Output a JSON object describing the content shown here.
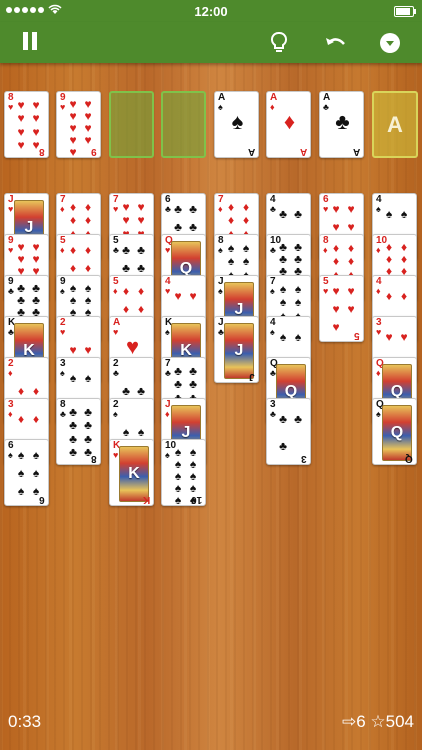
{
  "status": {
    "time": "12:00"
  },
  "toolbar": {
    "pause": "pause-icon",
    "hint": "lightbulb-icon",
    "undo": "undo-icon",
    "menu": "menu-dropdown-icon"
  },
  "freecells": [
    {
      "rank": "8",
      "suit": "♥",
      "color": "red"
    },
    {
      "rank": "9",
      "suit": "♥",
      "color": "red"
    },
    null,
    null
  ],
  "foundations": [
    {
      "rank": "A",
      "suit": "♠",
      "color": "black"
    },
    {
      "rank": "A",
      "suit": "♦",
      "color": "red"
    },
    {
      "rank": "A",
      "suit": "♣",
      "color": "black"
    },
    {
      "placeholder": "A"
    }
  ],
  "tableau": [
    [
      {
        "rank": "J",
        "suit": "♥",
        "color": "red"
      },
      {
        "rank": "9",
        "suit": "♥",
        "color": "red"
      },
      {
        "rank": "9",
        "suit": "♣",
        "color": "black"
      },
      {
        "rank": "K",
        "suit": "♣",
        "color": "black"
      },
      {
        "rank": "2",
        "suit": "♦",
        "color": "red"
      },
      {
        "rank": "3",
        "suit": "♦",
        "color": "red"
      },
      {
        "rank": "6",
        "suit": "♠",
        "color": "black"
      }
    ],
    [
      {
        "rank": "7",
        "suit": "♦",
        "color": "red"
      },
      {
        "rank": "5",
        "suit": "♦",
        "color": "red"
      },
      {
        "rank": "9",
        "suit": "♠",
        "color": "black"
      },
      {
        "rank": "2",
        "suit": "♥",
        "color": "red"
      },
      {
        "rank": "3",
        "suit": "♠",
        "color": "black"
      },
      {
        "rank": "8",
        "suit": "♣",
        "color": "black"
      }
    ],
    [
      {
        "rank": "7",
        "suit": "♥",
        "color": "red"
      },
      {
        "rank": "5",
        "suit": "♣",
        "color": "black"
      },
      {
        "rank": "5",
        "suit": "♦",
        "color": "red"
      },
      {
        "rank": "A",
        "suit": "♥",
        "color": "red"
      },
      {
        "rank": "2",
        "suit": "♣",
        "color": "black"
      },
      {
        "rank": "2",
        "suit": "♠",
        "color": "black"
      },
      {
        "rank": "K",
        "suit": "♥",
        "color": "red"
      }
    ],
    [
      {
        "rank": "6",
        "suit": "♣",
        "color": "black"
      },
      {
        "rank": "Q",
        "suit": "♥",
        "color": "red"
      },
      {
        "rank": "4",
        "suit": "♥",
        "color": "red"
      },
      {
        "rank": "K",
        "suit": "♠",
        "color": "black"
      },
      {
        "rank": "7",
        "suit": "♣",
        "color": "black"
      },
      {
        "rank": "J",
        "suit": "♦",
        "color": "red"
      },
      {
        "rank": "10",
        "suit": "♠",
        "color": "black"
      }
    ],
    [
      {
        "rank": "7",
        "suit": "♦",
        "color": "red"
      },
      {
        "rank": "8",
        "suit": "♠",
        "color": "black"
      },
      {
        "rank": "J",
        "suit": "♠",
        "color": "black"
      },
      {
        "rank": "J",
        "suit": "♣",
        "color": "black"
      }
    ],
    [
      {
        "rank": "4",
        "suit": "♣",
        "color": "black"
      },
      {
        "rank": "10",
        "suit": "♣",
        "color": "black"
      },
      {
        "rank": "7",
        "suit": "♠",
        "color": "black"
      },
      {
        "rank": "4",
        "suit": "♠",
        "color": "black"
      },
      {
        "rank": "Q",
        "suit": "♣",
        "color": "black"
      },
      {
        "rank": "3",
        "suit": "♣",
        "color": "black"
      }
    ],
    [
      {
        "rank": "6",
        "suit": "♥",
        "color": "red"
      },
      {
        "rank": "8",
        "suit": "♦",
        "color": "red"
      },
      {
        "rank": "5",
        "suit": "♥",
        "color": "red"
      }
    ],
    [
      {
        "rank": "4",
        "suit": "♠",
        "color": "black"
      },
      {
        "rank": "10",
        "suit": "♦",
        "color": "red"
      },
      {
        "rank": "4",
        "suit": "♦",
        "color": "red"
      },
      {
        "rank": "3",
        "suit": "♥",
        "color": "red"
      },
      {
        "rank": "Q",
        "suit": "♦",
        "color": "red"
      },
      {
        "rank": "Q",
        "suit": "♠",
        "color": "black"
      }
    ]
  ],
  "footer": {
    "timer": "0:33",
    "moves": "⇨6",
    "score": "☆504"
  },
  "colors": {
    "toolbar": "#4e8a2c",
    "red_suit": "#d8221f",
    "black_suit": "#111111"
  }
}
